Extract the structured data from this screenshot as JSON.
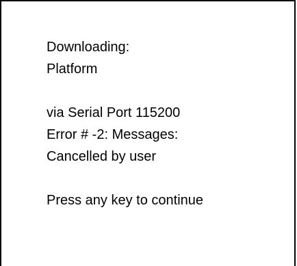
{
  "dialog": {
    "lines": {
      "downloading_label": "Downloading:",
      "target": "Platform",
      "connection": "via Serial Port 115200",
      "error_label": "Error # -2: Messages:",
      "error_message": "Cancelled by user",
      "prompt": "Press any key to continue"
    }
  },
  "colors": {
    "background": "#ffffff",
    "text": "#000000",
    "border": "#000000"
  }
}
